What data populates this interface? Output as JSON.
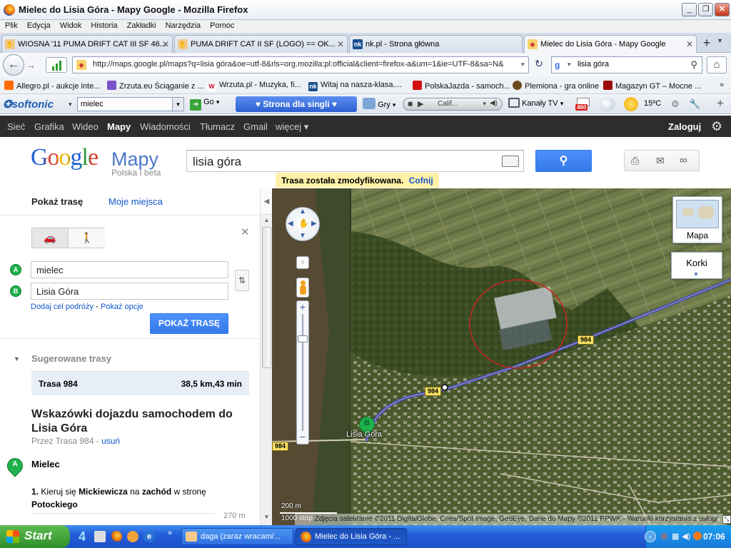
{
  "window": {
    "title": "Mielec do Lisia Góra - Mapy Google - Mozilla Firefox"
  },
  "menu": [
    "Plik",
    "Edycja",
    "Widok",
    "Historia",
    "Zakładki",
    "Narzędzia",
    "Pomoc"
  ],
  "tabs": [
    {
      "label": "WIOSNA '11 PUMA DRIFT CAT III SF 46...",
      "icon": "hand-icon"
    },
    {
      "label": "PUMA DRIFT CAT II SF (LOGO) == OK...",
      "icon": "hand-icon"
    },
    {
      "label": "nk.pl - Strona główna",
      "icon": "nk-icon"
    },
    {
      "label": "Mielec do Lisia Góra - Mapy Google",
      "icon": "google-maps-icon",
      "active": true
    }
  ],
  "nav": {
    "url": "http://maps.google.pl/maps?q=lisia góra&oe=utf-8&rls=org.mozilla:pl:official&client=firefox-a&um=1&ie=UTF-8&sa=N&",
    "search_value": "lisia góra"
  },
  "bookmarks": [
    {
      "label": "Allegro.pl - aukcje inte...",
      "color": "#ff6a00"
    },
    {
      "label": "Zrzuta.eu Ściąganie z ...",
      "color": "#7a55c9"
    },
    {
      "label": "Wrzuta.pl - Muzyka, fi...",
      "color": "#c8102e",
      "glyph": "W"
    },
    {
      "label": "Witaj na nasza-klasa....",
      "color": "#1a4f8f",
      "glyph": "nk"
    },
    {
      "label": "PolskaJazda - samoch...",
      "color": "#d01010"
    },
    {
      "label": "Plemiona - gra online",
      "color": "#6b4b1c"
    },
    {
      "label": "Magazyn GT – Mocne ...",
      "color": "#9b0d0d"
    }
  ],
  "softonic": {
    "brand": "softonic",
    "search_value": "mielec",
    "go_label": "Go",
    "banner_label": "♥ Strona dla singli ♥",
    "games_label": "Gry",
    "radio_label": "Calif...",
    "tv_label": "Kanały TV",
    "mail_count": "460",
    "temperature": "15ºC"
  },
  "gbar": {
    "links": [
      "Sieć",
      "Grafika",
      "Wideo",
      "Mapy",
      "Wiadomości",
      "Tłumacz",
      "Gmail",
      "więcej ▾"
    ],
    "active": "Mapy",
    "login": "Zaloguj"
  },
  "header": {
    "logo_google": "Google",
    "logo_maps": "Mapy",
    "logo_sub": "Polska I beta",
    "search_value": "lisia góra",
    "notice": "Trasa została zmodyfikowana.",
    "undo": "Cofnij"
  },
  "panel": {
    "tab_directions": "Pokaż trasę",
    "tab_places": "Moje miejsca",
    "from": "mielec",
    "to": "Lisia Góra",
    "pin_a": "A",
    "pin_b": "B",
    "add_destination": "Dodaj cel podróży",
    "separator": "-",
    "show_options": "Pokaż opcje",
    "submit": "POKAŻ TRASĘ",
    "suggested": "Sugerowane trasy",
    "route_name": "Trasa 984",
    "route_stats": "38,5 km,43 min",
    "directions_title": "Wskazówki dojazdu samochodem do Lisia Góra",
    "via": "Przez Trasa 984 -",
    "remove": "usuń",
    "start_place": "Mielec",
    "step_number": "1.",
    "step_text_1": "Kieruj się",
    "step_street": "Mickiewicza",
    "step_text_2": "na",
    "step_dir": "zachód",
    "step_text_3": "w stronę",
    "step_target": "Potockiego",
    "step_distance": "270 m"
  },
  "map": {
    "pin_b": "B",
    "place_label": "Lisia Góra",
    "road_shields": [
      "984",
      "984",
      "984",
      "984"
    ],
    "map_type_label": "Mapa",
    "traffic_label": "Korki",
    "scale_metric": "200 m",
    "scale_imperial": "1000 stóp",
    "copyright": "Zdjęcia satelitarne ©2011 DigitalGlobe, Cnes/Spot Image, GeoEye, Dane do Mapy ©2011 PPWK - Warunki korzystania z usługi"
  },
  "taskbar": {
    "start": "Start",
    "items": [
      "daga (zaraz wracam/...",
      "Mielec do Lisia Góra - ..."
    ],
    "clock": "07:06"
  }
}
